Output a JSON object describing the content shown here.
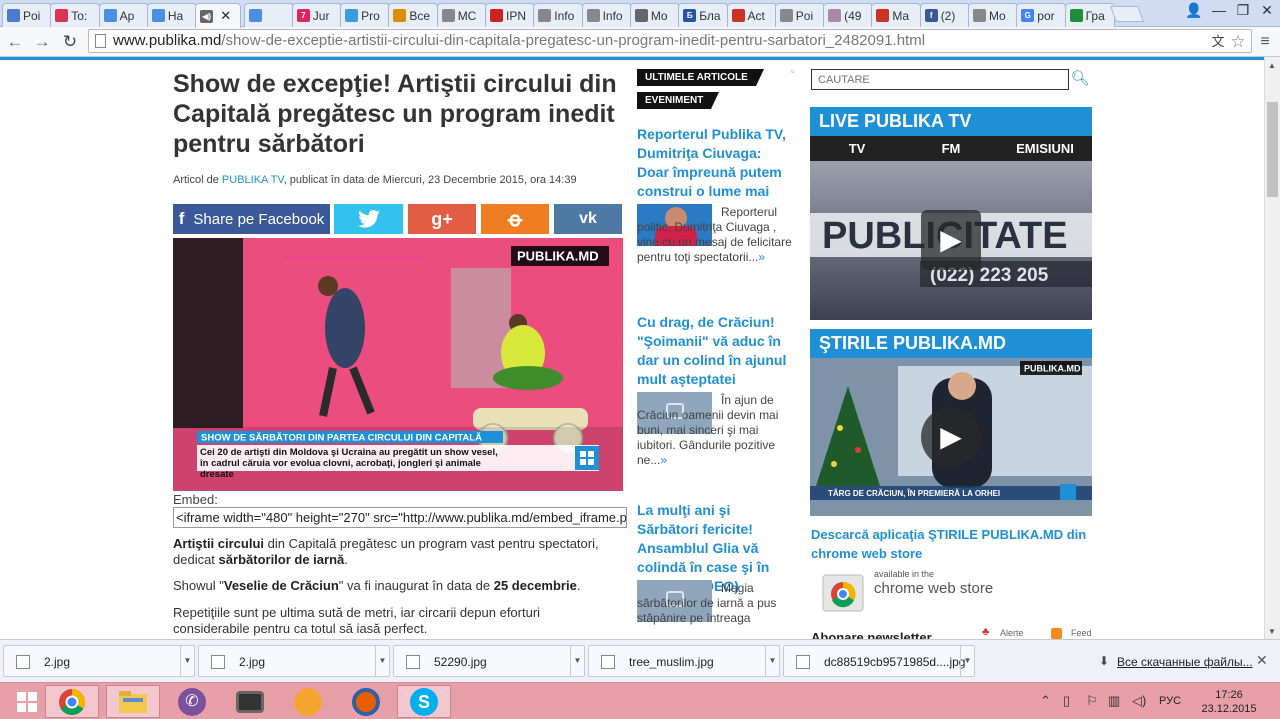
{
  "browser": {
    "tabs": [
      {
        "label": "Poi",
        "color": "#4a7bd0",
        "glyph": ""
      },
      {
        "label": "To:",
        "color": "#dd3355",
        "glyph": ""
      },
      {
        "label": "Ap",
        "color": "#4a90e2",
        "glyph": ""
      },
      {
        "label": "Ha",
        "color": "#4a90e2",
        "glyph": ""
      },
      {
        "label": "",
        "color": "#666666",
        "glyph": "◀)"
      },
      {
        "label": "",
        "color": "#4a90e2",
        "glyph": ""
      },
      {
        "label": "Jur",
        "color": "#e0245e",
        "glyph": "7"
      },
      {
        "label": "Pro",
        "color": "#3b9be0",
        "glyph": ""
      },
      {
        "label": "Bce",
        "color": "#e08a00",
        "glyph": ""
      },
      {
        "label": "MC",
        "color": "#888888",
        "glyph": ""
      },
      {
        "label": "IPN",
        "color": "#cc2222",
        "glyph": ""
      },
      {
        "label": "Info",
        "color": "#888888",
        "glyph": ""
      },
      {
        "label": "Info",
        "color": "#888888",
        "glyph": ""
      },
      {
        "label": "Mo",
        "color": "#666666",
        "glyph": ""
      },
      {
        "label": "Бла",
        "color": "#2255aa",
        "glyph": "Б"
      },
      {
        "label": "Act",
        "color": "#cc3322",
        "glyph": ""
      },
      {
        "label": "Poi",
        "color": "#888888",
        "glyph": ""
      },
      {
        "label": "(49",
        "color": "#aa88aa",
        "glyph": ""
      },
      {
        "label": "Ma",
        "color": "#cc3322",
        "glyph": ""
      },
      {
        "label": "(2)",
        "color": "#3b5998",
        "glyph": "f"
      },
      {
        "label": "Mo",
        "color": "#888888",
        "glyph": ""
      },
      {
        "label": "por",
        "color": "#4285f4",
        "glyph": "G"
      },
      {
        "label": "Гра",
        "color": "#1e8e3e",
        "glyph": ""
      }
    ],
    "url_host": "www.publika.md",
    "url_path": "/show-de-exceptie-artistii-circului-din-capitala-pregatesc-un-program-inedit-pentru-sarbatori_2482091.html"
  },
  "article": {
    "title": "Show de excepţie! Artiştii circului din Capitală pregătesc un program inedit pentru sărbători",
    "meta_prefix": "Articol de ",
    "meta_author": "PUBLIKA TV",
    "meta_suffix": ", publicat în data de Miercuri, 23 Decembrie 2015, ora 14:39",
    "share_facebook": "Share pe Facebook",
    "share_colors": {
      "facebook": "#3b5998",
      "twitter": "#33c1f0",
      "google": "#e35c44",
      "ok": "#ef7d21",
      "vk": "#4c7aa5"
    },
    "video_logo": "PUBLIKA.MD",
    "video_caption_title": "SHOW DE SĂRBĂTORI DIN PARTEA CIRCULUI DIN CAPITALĂ",
    "video_caption_text": "Cei 20 de artişti din Moldova şi Ucraina au pregătit un show vesel, în cadrul căruia vor evolua clovni, acrobaţi, jongleri şi animale dresate",
    "embed_label": "Embed:",
    "embed_code": "<iframe width=\"480\" height=\"270\" src=\"http://www.publika.md/embed_iframe.php?",
    "p1_b1": "Artiştii circului",
    "p1_t1": " din Capitală pregătesc un program vast pentru spectatori, dedicat ",
    "p1_b2": "sărbătorilor de iarnă",
    "p1_t2": ".",
    "p2_t1": "Showul \"",
    "p2_b1": "Veselie de Crăciun",
    "p2_t2": "\" va fi inaugurat în data de ",
    "p2_b2": "25 decembrie",
    "p2_t3": ".",
    "p3": "Repetiţiile sunt pe ultima sută de metri, iar circarii depun eforturi considerabile pentru ca totul să iasă perfect."
  },
  "middle": {
    "tag1": "ULTIMELE ARTICOLE",
    "tag2": "EVENIMENT",
    "more": "»",
    "items": [
      {
        "title": "Reporterul Publika TV, Dumitriţa Ciuvaga: Doar împreună putem construi o lume mai",
        "text": "Reporterul politic, Dumitriţa Ciuvaga , vine cu un mesaj de felicitare pentru toţi spectatorii..."
      },
      {
        "title": "Cu drag, de Crăciun! \"Şoimanii\" vă aduc în dar un colind în ajunul mult aşteptatei",
        "text": "În ajun de Crăciun oamenii devin mai buni, mai sinceri şi mai iubitori. Gândurile pozitive ne..."
      },
      {
        "title": "La mulţi ani şi Sărbători fericite! Ansamblul Glia vă colindă în case şi în suflete (VIDEO)",
        "text": "Magia sărbătorilor de iarnă a pus stăpânire pe întreaga"
      }
    ]
  },
  "right": {
    "search_placeholder": "CAUTARE",
    "live_title": "LIVE PUBLIKA TV",
    "tv_tabs": [
      "TV",
      "FM",
      "EMISIUNI"
    ],
    "live_video_text1": "PUBLICITATE",
    "live_video_text2": "(022) 223 205",
    "stirile_title": "ŞTIRILE PUBLIKA.MD",
    "stirile_logo": "PUBLIKA.MD",
    "stirile_caption": "TÂRG DE CRĂCIUN, ÎN PREMIERĂ LA ORHEI",
    "store_link": "Descarcă aplicaţia ŞTIRILE PUBLIKA.MD din chrome web store",
    "store_badge_small": "available in the",
    "store_badge_big": "chrome web store",
    "newsletter": "Abonare newsletter",
    "alerts": "Alerte",
    "feed": "Feed"
  },
  "downloads": {
    "items": [
      "2.jpg",
      "2.jpg",
      "52290.jpg",
      "tree_muslim.jpg",
      "dc88519cb9571985d....jpg"
    ],
    "show_all": "Все скачанные файлы..."
  },
  "taskbar": {
    "lang": "РУС",
    "time": "17:26",
    "date": "23.12.2015"
  }
}
